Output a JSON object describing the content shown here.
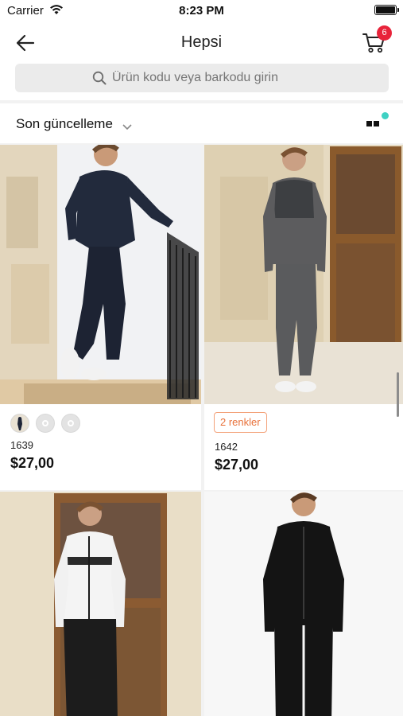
{
  "status_bar": {
    "carrier": "Carrier",
    "time": "8:23 PM"
  },
  "nav": {
    "title": "Hepsi",
    "cart_count": "6",
    "back_icon": "arrow-left-icon",
    "cart_icon": "cart-icon"
  },
  "search": {
    "placeholder": "Ürün kodu veya barkodu girin",
    "icon": "search-icon"
  },
  "filter": {
    "sort_label": "Son güncelleme",
    "layout_icon": "grid-layout-icon"
  },
  "products": [
    {
      "code": "1639",
      "price": "$27,00",
      "swatch_count": 3,
      "colors": [
        "#1d2436",
        "#e3e3e3",
        "#e3e3e3"
      ]
    },
    {
      "code": "1642",
      "price": "$27,00",
      "color_label": "2 renkler"
    },
    {
      "code": "",
      "price": ""
    },
    {
      "code": "",
      "price": ""
    }
  ],
  "colors": {
    "accent_badge": "#e8233a",
    "teal_dot": "#3fd1c3",
    "orange_label": "#e8713a"
  }
}
